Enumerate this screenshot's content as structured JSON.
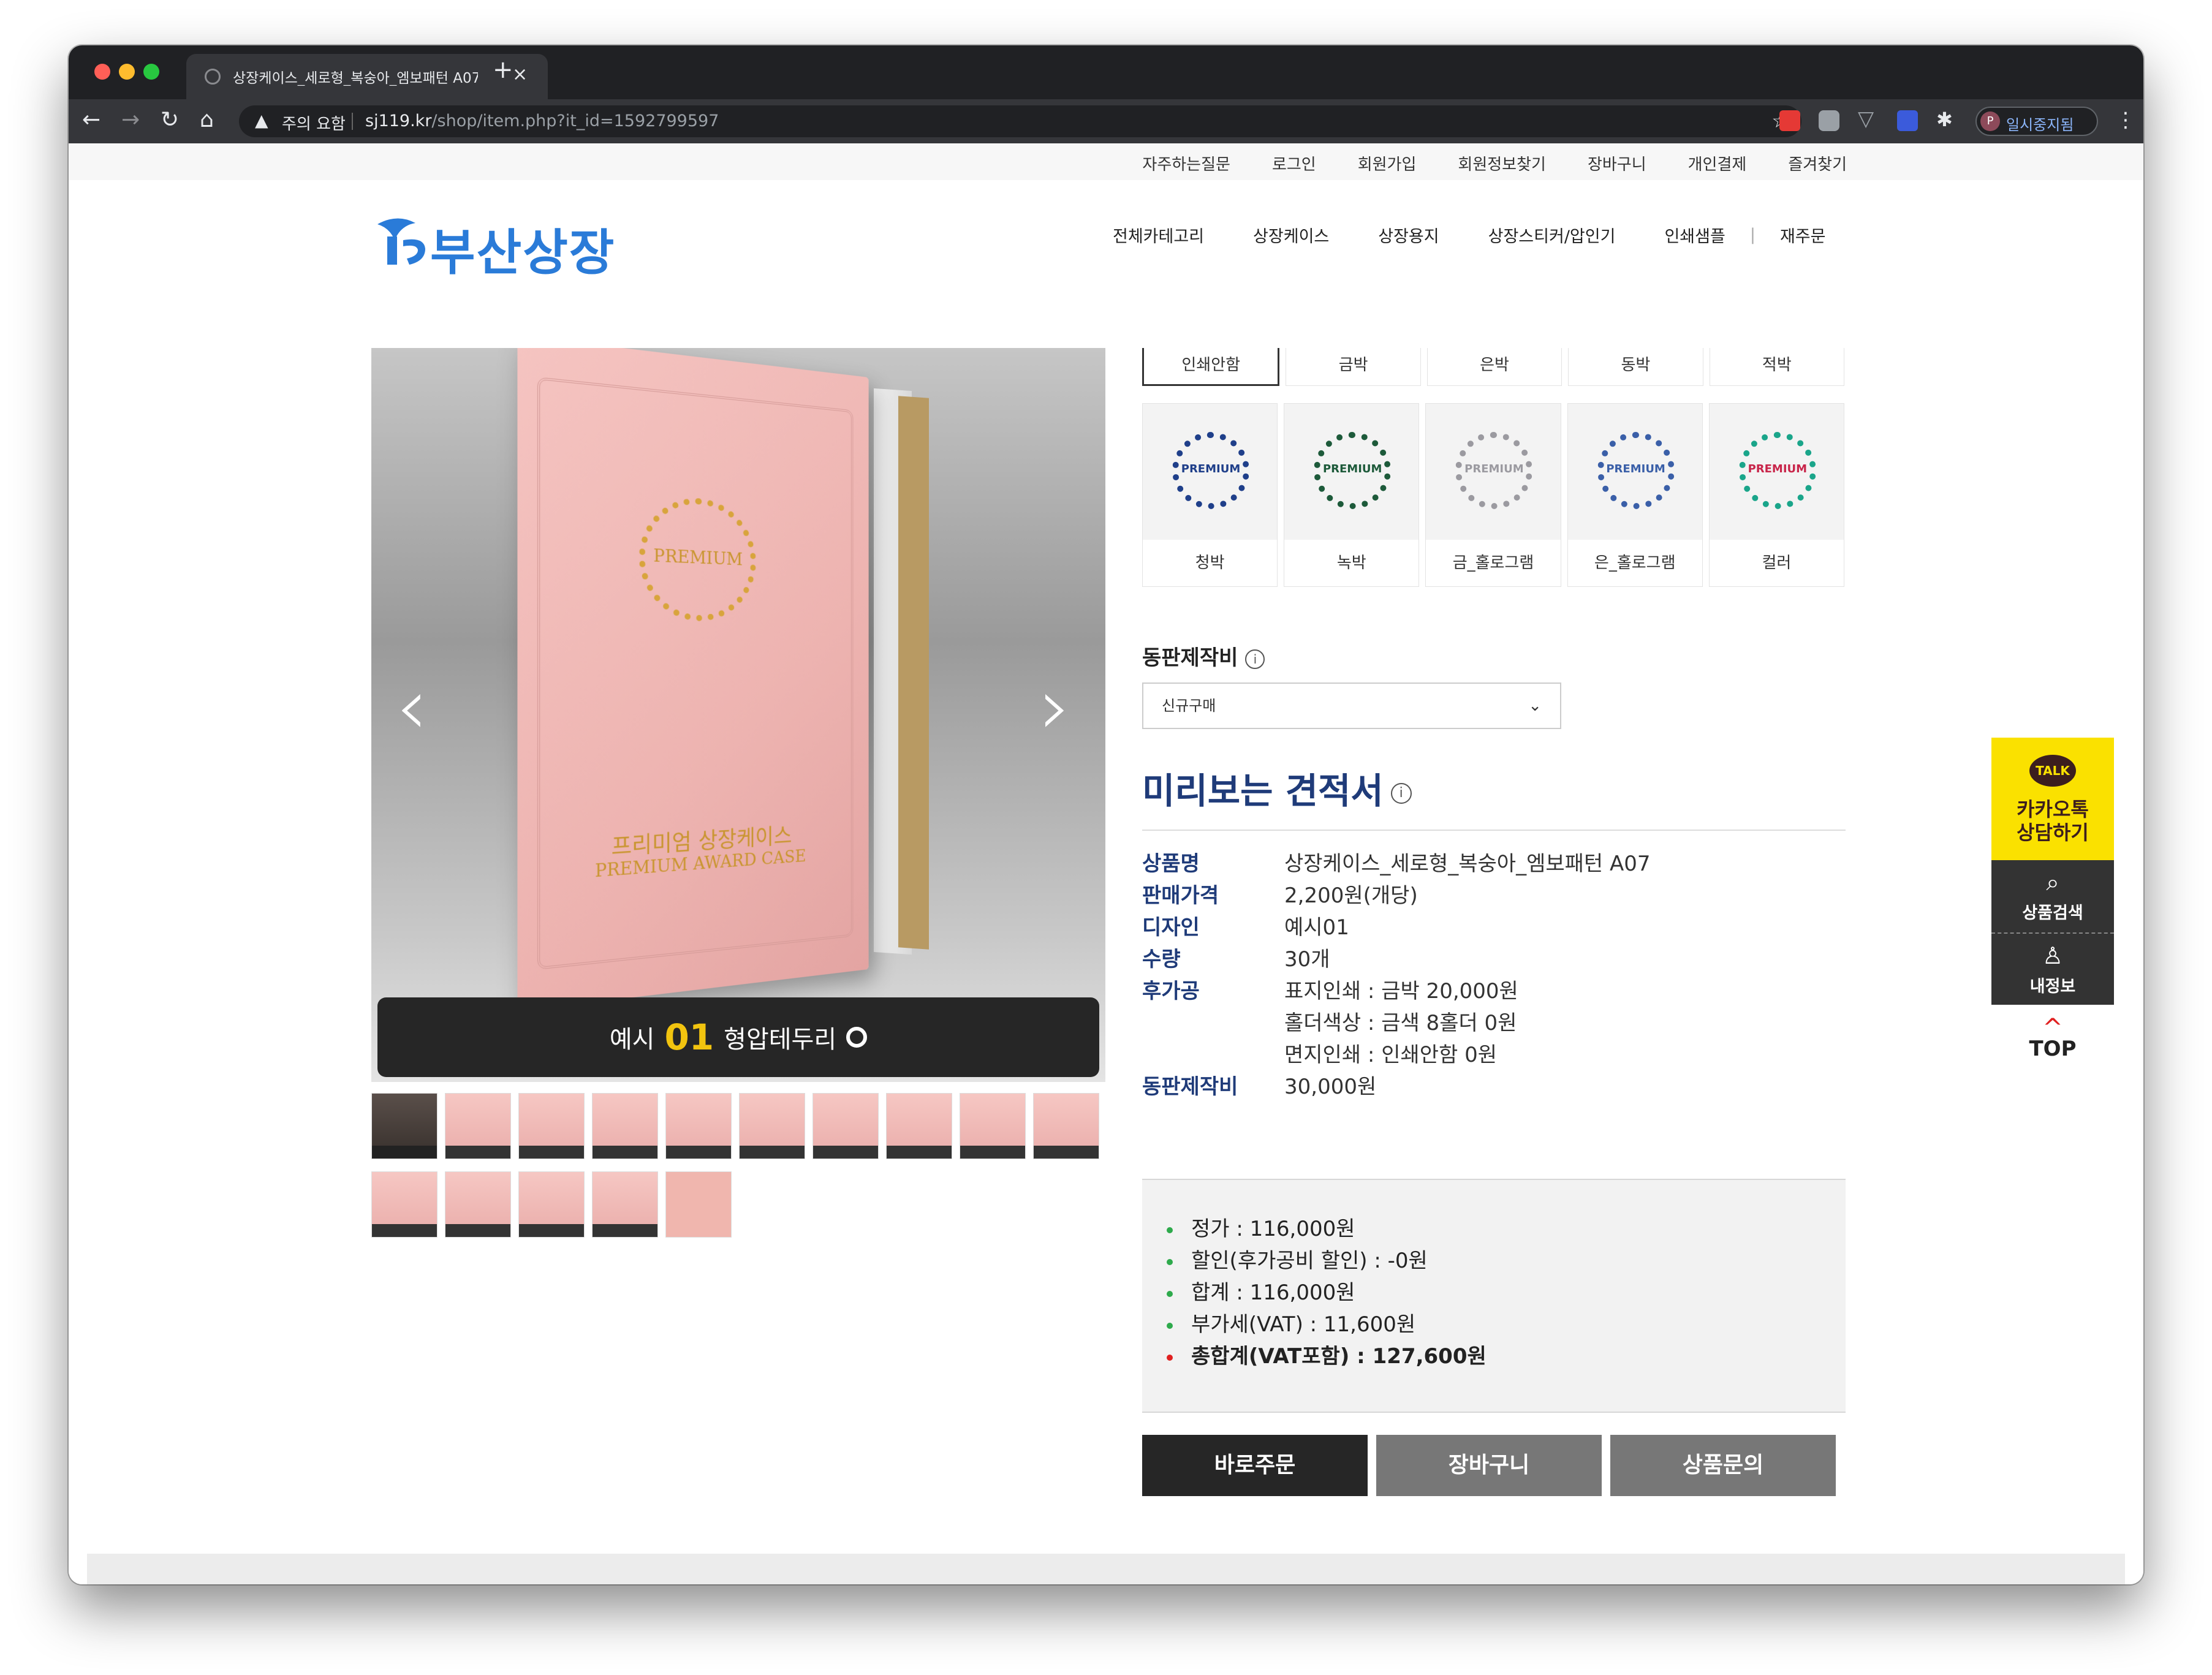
{
  "browser": {
    "tab_title": "상장케이스_세로형_복숭아_엠보패턴 A07",
    "tab_close": "×",
    "new_tab": "+",
    "security_warning": "주의 요함",
    "url_host": "sj119.kr",
    "url_path": "/shop/item.php?it_id=1592799597",
    "profile_initial": "P",
    "profile_label": "일시중지됨"
  },
  "top_links": [
    "자주하는질문",
    "로그인",
    "회원가입",
    "회원정보찾기",
    "장바구니",
    "개인결제",
    "즐겨찾기"
  ],
  "logo": {
    "text": "부산상장"
  },
  "main_nav": [
    "전체카테고리",
    "상장케이스",
    "상장용지",
    "상장스티커/압인기",
    "인쇄샘플",
    "재주문"
  ],
  "gallery": {
    "case_text_kr": "프리미엄 상장케이스",
    "case_text_en": "PREMIUM AWARD CASE",
    "emblem_word": "PREMIUM",
    "caption_prefix": "예시",
    "caption_number": "01",
    "caption_suffix": "형압테두리"
  },
  "foil_tabs": [
    "인쇄안함",
    "금박",
    "은박",
    "동박",
    "적박"
  ],
  "swatches": [
    {
      "label": "청박",
      "word": "PREMIUM",
      "color": "#1f3f8a"
    },
    {
      "label": "녹박",
      "word": "PREMIUM",
      "color": "#1d5a3a"
    },
    {
      "label": "금_홀로그램",
      "word": "PREMIUM",
      "color": "#9b9aa0"
    },
    {
      "label": "은_홀로그램",
      "word": "PREMIUM",
      "color": "#3a5fa8"
    },
    {
      "label": "컬러",
      "word": "PREMIUM",
      "color": "#1aa58a"
    }
  ],
  "plate": {
    "label": "동판제작비",
    "info": "i",
    "select_value": "신규구매"
  },
  "estimate": {
    "title": "미리보는 견적서",
    "info": "i",
    "rows": [
      {
        "key": "상품명",
        "value": "상장케이스_세로형_복숭아_엠보패턴 A07"
      },
      {
        "key": "판매가격",
        "value": "2,200원(개당)"
      },
      {
        "key": "디자인",
        "value": "예시01"
      },
      {
        "key": "수량",
        "value": "30개"
      },
      {
        "key": "후가공",
        "value": "표지인쇄 : 금박 20,000원"
      },
      {
        "key": "",
        "value": "홀더색상 : 금색 8홀더 0원"
      },
      {
        "key": "",
        "value": "면지인쇄 : 인쇄안함 0원"
      },
      {
        "key": "동판제작비",
        "value": "30,000원"
      }
    ]
  },
  "summary": [
    {
      "text": "정가 : 116,000원"
    },
    {
      "text": "할인(후가공비 할인) : -0원"
    },
    {
      "text": "합계 : 116,000원"
    },
    {
      "text": "부가세(VAT) : 11,600원"
    },
    {
      "text": "총합계(VAT포함) : 127,600원"
    }
  ],
  "buttons": {
    "order": "바로주문",
    "cart": "장바구니",
    "inquiry": "상품문의"
  },
  "side_menu": {
    "kakao_badge": "TALK",
    "kakao_line1": "카카오톡",
    "kakao_line2": "상담하기",
    "search": "상품검색",
    "my_info": "내정보",
    "top": "TOP"
  },
  "colors": {
    "accent_navy": "#1f3b79",
    "kakao_yellow": "#fae100",
    "logo_blue": "#2a7bd8"
  }
}
